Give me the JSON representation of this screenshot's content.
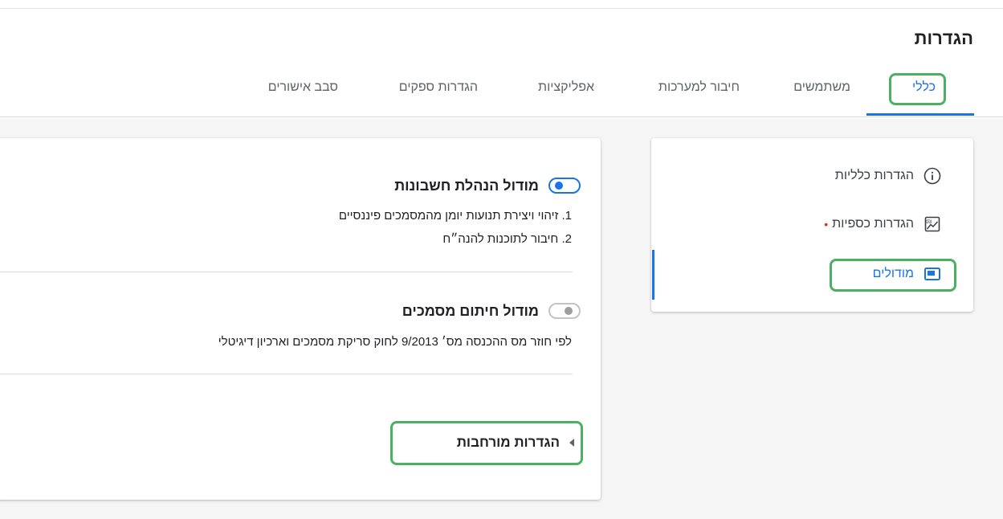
{
  "header": {
    "title": "הגדרות"
  },
  "tabs": [
    {
      "label": "כללי"
    },
    {
      "label": "משתמשים"
    },
    {
      "label": "חיבור למערכות"
    },
    {
      "label": "אפליקציות"
    },
    {
      "label": "הגדרות ספקים"
    },
    {
      "label": "סבב אישורים"
    }
  ],
  "sidebar": {
    "items": [
      {
        "label": "הגדרות כלליות",
        "icon": "info-icon"
      },
      {
        "label": "הגדרות כספיות",
        "icon": "finance-chart-icon",
        "required_mark": "•"
      },
      {
        "label": "מודולים",
        "icon": "module-window-icon"
      }
    ]
  },
  "modules": [
    {
      "title": "מודול הנהלת חשבונות",
      "enabled": true,
      "lines": [
        "1. זיהוי ויצירת תנועות יומן מהמסמכים פיננסיים",
        "2. חיבור לתוכנות להנה״ח"
      ]
    },
    {
      "title": "מודול חיתום מסמכים",
      "enabled": false,
      "lines": [
        "לפי חוזר מס ההכנסה מס׳ 9/2013 לחוק סריקת מסמכים וארכיון דיגיטלי"
      ]
    }
  ],
  "advanced": {
    "label": "הגדרות מורחבות"
  },
  "colors": {
    "accent": "#1a73e8",
    "highlight": "#4caf64",
    "required": "#d93025"
  }
}
